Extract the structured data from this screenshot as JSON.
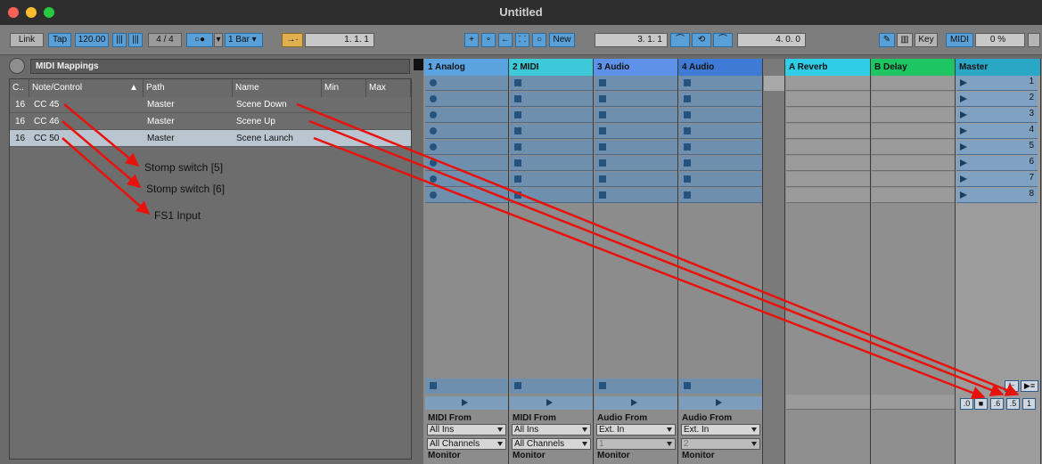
{
  "window": {
    "title": "Untitled"
  },
  "control_bar": {
    "link": "Link",
    "tap": "Tap",
    "tempo": "120.00",
    "signature": "4 / 4",
    "quantize": "1 Bar",
    "arrangement_position": "1.   1.   1",
    "loop_start": "3.   1.   1",
    "loop_length": "4.   0.   0",
    "new_label": "New",
    "key_label": "Key",
    "midi_label": "MIDI",
    "cpu": "0 %"
  },
  "mappings": {
    "browser_title": "MIDI Mappings",
    "columns": [
      "C..",
      "Note/Control",
      "Path",
      "Name",
      "Min",
      "Max"
    ],
    "rows": [
      {
        "channel": "16",
        "control": "CC 45",
        "path": "Master",
        "name": "Scene Down"
      },
      {
        "channel": "16",
        "control": "CC 46",
        "path": "Master",
        "name": "Scene Up"
      },
      {
        "channel": "16",
        "control": "CC 50",
        "path": "Master",
        "name": "Scene Launch"
      }
    ],
    "annotations": [
      "Stomp switch [5]",
      "Stomp switch [6]",
      "FS1 Input"
    ]
  },
  "tracks": [
    {
      "name": "1 Analog",
      "color": "#5aa3e0",
      "io_from_label": "MIDI From",
      "io_from": "All Ins",
      "io_channel": "All Channels",
      "monitor": "Monitor"
    },
    {
      "name": "2 MIDI",
      "color": "#3ec9d8",
      "io_from_label": "MIDI From",
      "io_from": "All Ins",
      "io_channel": "All Channels",
      "monitor": "Monitor"
    },
    {
      "name": "3 Audio",
      "color": "#5e92e8",
      "io_from_label": "Audio From",
      "io_from": "Ext. In",
      "io_channel": "1",
      "monitor": "Monitor"
    },
    {
      "name": "4 Audio",
      "color": "#3f7bd6",
      "io_from_label": "Audio From",
      "io_from": "Ext. In",
      "io_channel": "2",
      "monitor": "Monitor"
    }
  ],
  "returns": [
    {
      "name": "A Reverb",
      "color": "#2fcde6"
    },
    {
      "name": "B Delay",
      "color": "#1ec663"
    }
  ],
  "master": {
    "name": "Master",
    "color": "#2aa7c4",
    "scenes": [
      "1",
      "2",
      "3",
      "4",
      "5",
      "6",
      "7",
      "8"
    ],
    "mini_buttons": [
      ".0",
      ".6",
      ".5",
      "1"
    ]
  }
}
